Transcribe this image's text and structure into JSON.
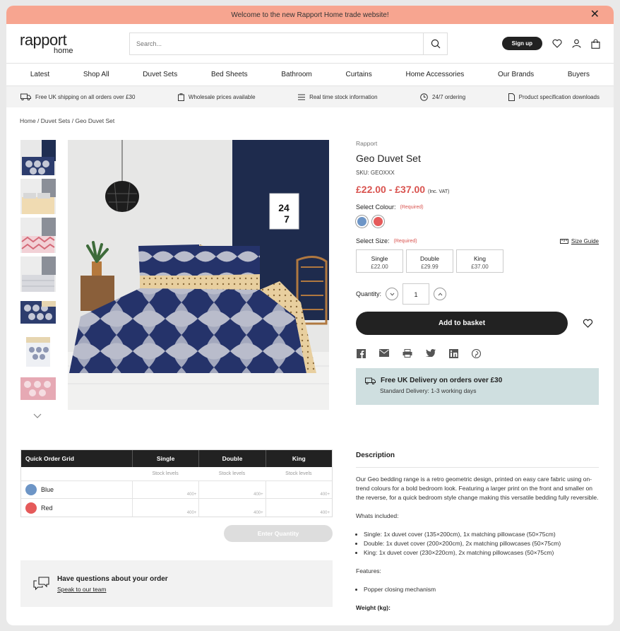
{
  "banner": {
    "text": "Welcome to the new Rapport Home trade website!"
  },
  "header": {
    "logo_top": "rapport",
    "logo_bottom": "home",
    "search_placeholder": "Search...",
    "signup": "Sign up"
  },
  "nav": [
    "Latest",
    "Shop All",
    "Duvet Sets",
    "Bed Sheets",
    "Bathroom",
    "Curtains",
    "Home Accessories",
    "Our Brands",
    "Buyers"
  ],
  "perks": [
    "Free UK shipping on all orders over £30",
    "Wholesale prices available",
    "Real time stock information",
    "24/7 ordering",
    "Product specification downloads"
  ],
  "breadcrumb": [
    "Home",
    "Duvet Sets",
    "Geo Duvet Set"
  ],
  "product": {
    "brand": "Rapport",
    "title": "Geo Duvet Set",
    "sku": "SKU: GEOXXX",
    "price": "£22.00 - £37.00",
    "price_note": "(Inc. VAT)",
    "select_colour": "Select Colour:",
    "select_size": "Select Size:",
    "required": "(Required)",
    "size_guide": "Size Guide",
    "colours": [
      {
        "name": "Blue",
        "hex": "#6d95c6"
      },
      {
        "name": "Red",
        "hex": "#e55a5a"
      }
    ],
    "sizes": [
      {
        "name": "Single",
        "price": "£22.00"
      },
      {
        "name": "Double",
        "price": "£29.99"
      },
      {
        "name": "King",
        "price": "£37.00"
      }
    ],
    "quantity_label": "Quantity:",
    "quantity": "1",
    "add_to_basket": "Add to basket",
    "frame_text": "24\n7"
  },
  "delivery": {
    "title": "Free UK Delivery on orders over £30",
    "subtitle": "Standard Delivery: 1-3 working days"
  },
  "quick_order": {
    "title": "Quick Order Grid",
    "columns": [
      "Single",
      "Double",
      "King"
    ],
    "stock_label": "Stock levels",
    "rows": [
      {
        "name": "Blue",
        "hex": "#6d95c6",
        "stock": [
          "400+",
          "400+",
          "400+"
        ]
      },
      {
        "name": "Red",
        "hex": "#e55a5a",
        "stock": [
          "400+",
          "400+",
          "400+"
        ]
      }
    ],
    "enter_quantity": "Enter Quantity"
  },
  "questions": {
    "title": "Have questions about your order",
    "link": "Speak to our team"
  },
  "description": {
    "heading": "Description",
    "body": "Our Geo bedding range is a retro geometric design, printed on easy care fabric using on-trend colours for a bold bedroom look. Featuring a larger print on the front and smaller on the reverse, for a quick bedroom style change making this versatile bedding fully reversible.",
    "whats_included_label": "Whats included:",
    "included": [
      "Single: 1x duvet cover (135×200cm), 1x matching pillowcase (50×75cm)",
      "Double: 1x duvet cover (200×200cm), 2x matching pillowcases (50×75cm)",
      "King: 1x duvet cover (230×220cm), 2x matching pillowcases (50×75cm)"
    ],
    "features_label": "Features:",
    "features": [
      "Popper closing mechanism"
    ],
    "weight_label": "Weight (kg):"
  }
}
